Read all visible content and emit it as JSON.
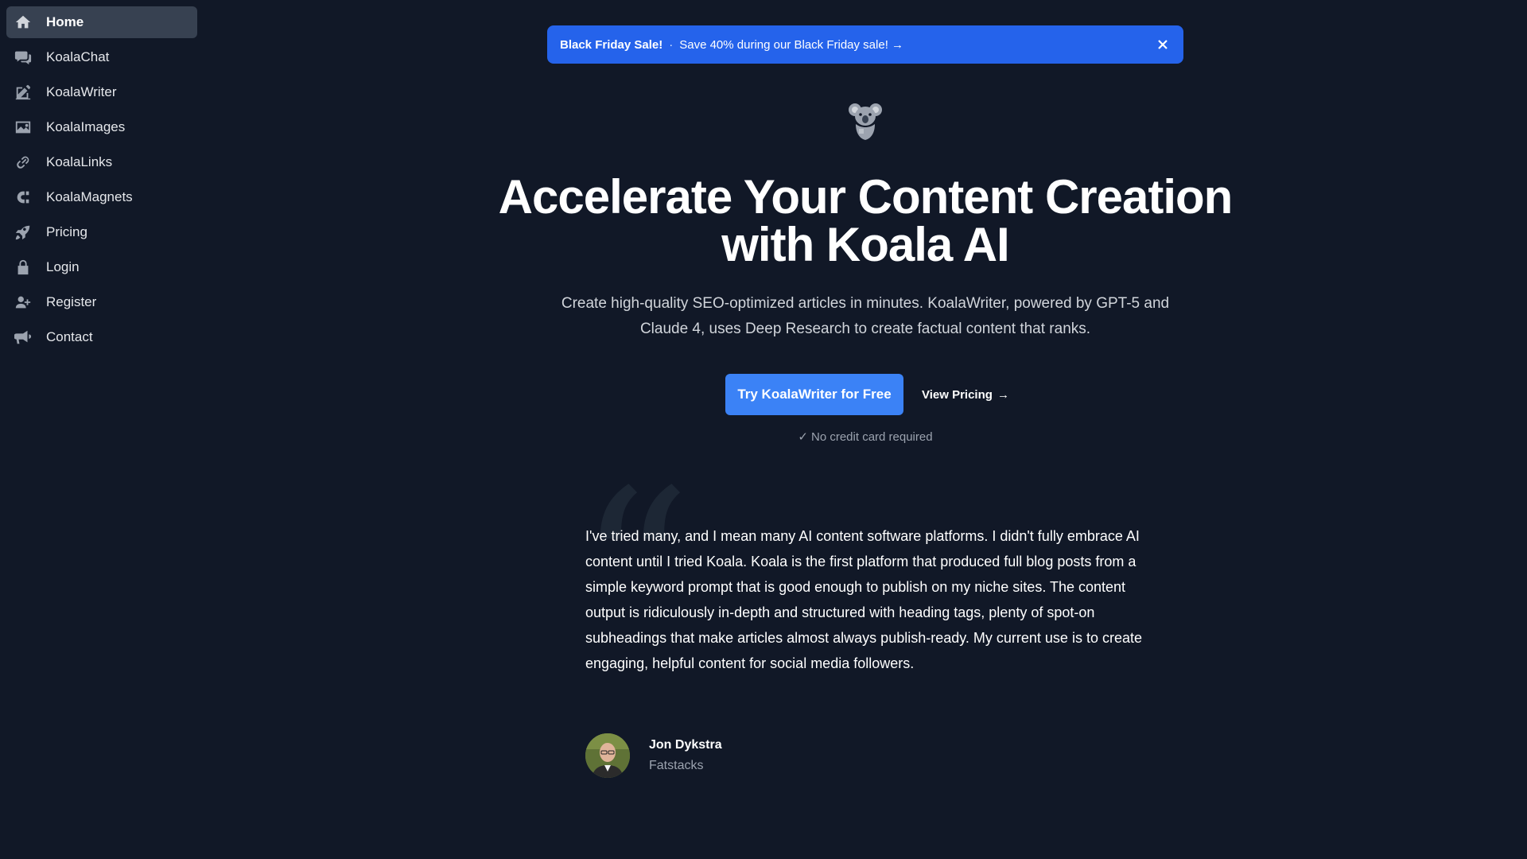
{
  "sidebar": {
    "items": [
      {
        "label": "Home",
        "icon": "home-icon"
      },
      {
        "label": "KoalaChat",
        "icon": "chat-icon"
      },
      {
        "label": "KoalaWriter",
        "icon": "pencil-icon"
      },
      {
        "label": "KoalaImages",
        "icon": "image-icon"
      },
      {
        "label": "KoalaLinks",
        "icon": "link-icon"
      },
      {
        "label": "KoalaMagnets",
        "icon": "magnet-icon"
      },
      {
        "label": "Pricing",
        "icon": "rocket-icon"
      },
      {
        "label": "Login",
        "icon": "lock-icon"
      },
      {
        "label": "Register",
        "icon": "user-plus-icon"
      },
      {
        "label": "Contact",
        "icon": "megaphone-icon"
      }
    ]
  },
  "banner": {
    "title": "Black Friday Sale!",
    "separator": "·",
    "text": "Save 40% during our Black Friday sale! →"
  },
  "hero": {
    "title_line1": "Accelerate Your Content Creation",
    "title_line2": "with Koala AI",
    "subtitle": "Create high-quality SEO-optimized articles in minutes. KoalaWriter, powered by GPT-5 and Claude 4, uses Deep Research to create factual content that ranks.",
    "cta_label": "Try KoalaWriter for Free",
    "secondary_label": "View Pricing",
    "secondary_arrow": "→",
    "note_check": "✓",
    "note": "No credit card required"
  },
  "testimonial": {
    "quote": "I've tried many, and I mean many AI content software platforms. I didn't fully embrace AI content until I tried Koala. Koala is the first platform that produced full blog posts from a simple keyword prompt that is good enough to publish on my niche sites. The content output is ridiculously in-depth and structured with heading tags, plenty of spot-on subheadings that make articles almost always publish-ready. My current use is to create engaging, helpful content for social media followers.",
    "author_name": "Jon Dykstra",
    "author_company": "Fatstacks"
  },
  "colors": {
    "background": "#111827",
    "sidebar_active": "#374151",
    "banner": "#2563eb",
    "cta": "#3b82f6"
  }
}
